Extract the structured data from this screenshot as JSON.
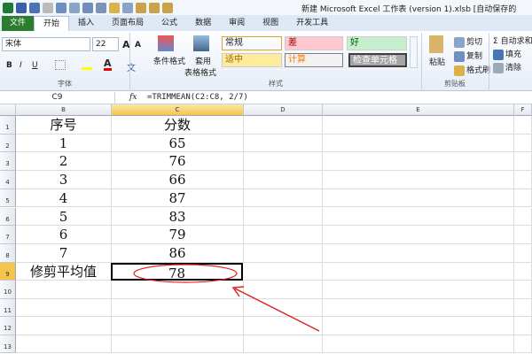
{
  "window": {
    "title": "新建 Microsoft Excel 工作表 (version 1).xlsb [自动保存的"
  },
  "tabs": [
    "文件",
    "开始",
    "插入",
    "页面布局",
    "公式",
    "数据",
    "审阅",
    "视图",
    "开发工具"
  ],
  "ribbon": {
    "font": {
      "name": "宋体",
      "size": "22",
      "group_label": "字体",
      "bold": "B",
      "italic": "I",
      "underline": "U",
      "grow": "A",
      "shrink": "A",
      "font_color": "A",
      "phonetic": "文"
    },
    "styles": {
      "group_label": "样式",
      "conditional_format": "条件格式",
      "table_format_1": "套用",
      "table_format_2": "表格格式",
      "cells": [
        {
          "label": "常规",
          "bg": "#ffffff",
          "fg": "#000000"
        },
        {
          "label": "差",
          "bg": "#ffc7ce",
          "fg": "#9c0006"
        },
        {
          "label": "好",
          "bg": "#c6efce",
          "fg": "#006100"
        },
        {
          "label": "适中",
          "bg": "#ffeb9c",
          "fg": "#9c6500"
        },
        {
          "label": "计算",
          "bg": "#f2f2f2",
          "fg": "#fa7d00"
        },
        {
          "label": "检查单元格",
          "bg": "#a5a5a5",
          "fg": "#ffffff"
        }
      ]
    },
    "clipboard": {
      "group_label": "剪贴板",
      "paste": "粘贴",
      "cut": "剪切",
      "copy": "复制",
      "format_painter": "格式刷"
    },
    "editing": {
      "autosum": "自动求和",
      "fill": "填充",
      "clear": "清除"
    }
  },
  "formula_bar": {
    "name_box": "C9",
    "fx": "fx",
    "formula": "=TRIMMEAN(C2:C8, 2/7)"
  },
  "columns": [
    "B",
    "C",
    "D",
    "E",
    "F"
  ],
  "rows": [
    "1",
    "2",
    "3",
    "4",
    "5",
    "6",
    "7",
    "8",
    "9",
    "10",
    "11",
    "12",
    "13"
  ],
  "table": {
    "header": [
      "序号",
      "分数"
    ],
    "data": [
      [
        "1",
        "65"
      ],
      [
        "2",
        "76"
      ],
      [
        "3",
        "66"
      ],
      [
        "4",
        "87"
      ],
      [
        "5",
        "83"
      ],
      [
        "6",
        "79"
      ],
      [
        "7",
        "86"
      ]
    ],
    "result": [
      "修剪平均值",
      "78"
    ]
  },
  "annotation_color": "#e02020"
}
